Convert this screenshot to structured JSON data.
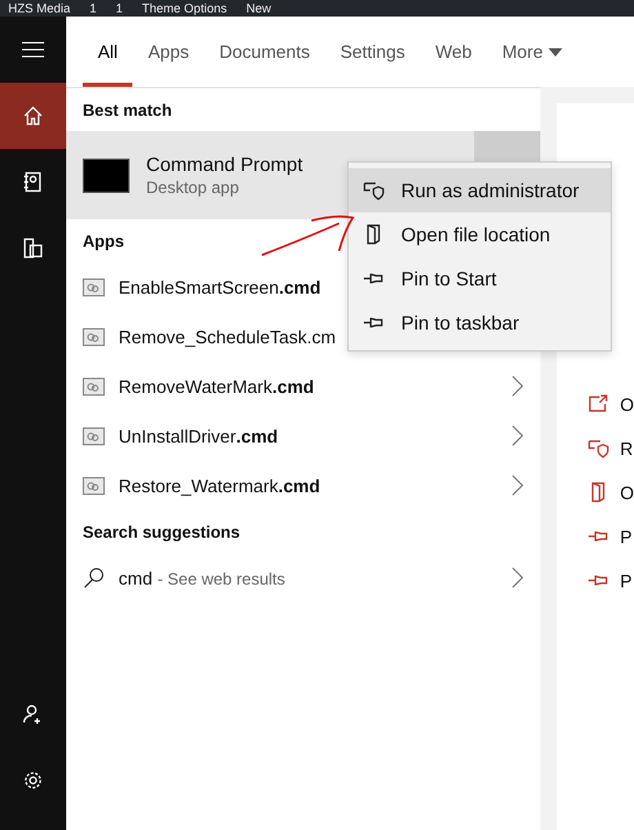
{
  "admin_bar": {
    "items": [
      "HZS Media",
      "1",
      "1",
      "Theme Options",
      "New"
    ]
  },
  "rail": {
    "items": [
      {
        "kind": "home",
        "selected": true
      },
      {
        "kind": "notebook",
        "selected": false
      },
      {
        "kind": "devices",
        "selected": false
      }
    ],
    "bottom": [
      {
        "kind": "user-add"
      },
      {
        "kind": "settings"
      }
    ]
  },
  "tabs": [
    {
      "label": "All",
      "selected": true
    },
    {
      "label": "Apps",
      "selected": false
    },
    {
      "label": "Documents",
      "selected": false
    },
    {
      "label": "Settings",
      "selected": false
    },
    {
      "label": "Web",
      "selected": false
    },
    {
      "label": "More",
      "selected": false,
      "dropdown": true
    }
  ],
  "best_match": {
    "heading": "Best match",
    "title": "Command Prompt",
    "subtitle": "Desktop app"
  },
  "apps": {
    "heading": "Apps",
    "items": [
      {
        "name": "EnableSmartScreen",
        "ext": ".cmd"
      },
      {
        "name": "Remove_ScheduleTask.cm"
      },
      {
        "name": "RemoveWaterMark",
        "ext": ".cmd"
      },
      {
        "name": "UnInstallDriver",
        "ext": ".cmd"
      },
      {
        "name": "Restore_Watermark",
        "ext": ".cmd"
      }
    ]
  },
  "search_suggestions": {
    "heading": "Search suggestions",
    "query": "cmd",
    "hint": "- See web results"
  },
  "context_menu": [
    {
      "label": "Run as administrator",
      "kind": "shield",
      "selected": true
    },
    {
      "label": "Open file location",
      "kind": "folder",
      "selected": false
    },
    {
      "label": "Pin to Start",
      "kind": "pin",
      "selected": false
    },
    {
      "label": "Pin to taskbar",
      "kind": "pin",
      "selected": false
    }
  ],
  "details_actions": [
    {
      "label": "O",
      "kind": "open"
    },
    {
      "label": "R",
      "kind": "shield"
    },
    {
      "label": "O",
      "kind": "folder"
    },
    {
      "label": "P",
      "kind": "pin"
    },
    {
      "label": "P",
      "kind": "pin"
    }
  ]
}
